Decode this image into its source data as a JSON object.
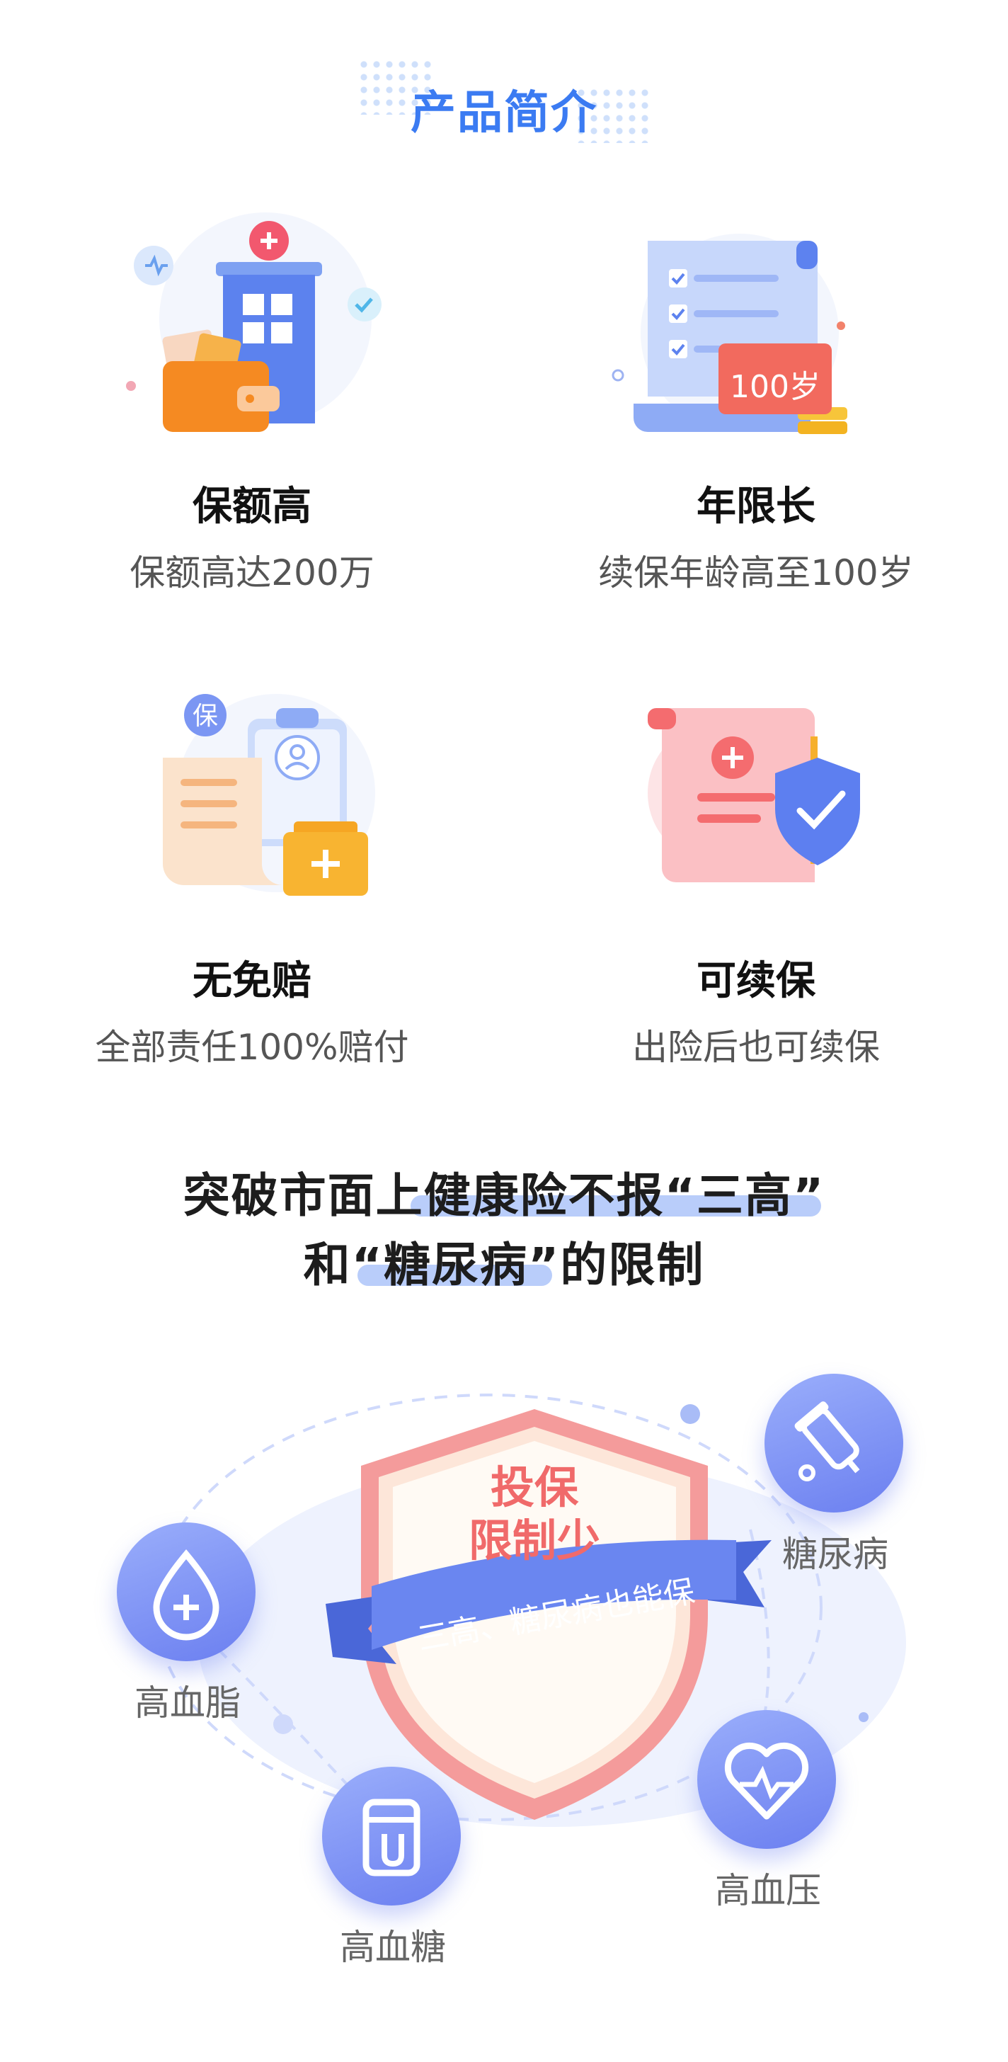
{
  "section": {
    "title": "产品简介"
  },
  "features": [
    {
      "title": "保额高",
      "desc": "保额高达200万"
    },
    {
      "title": "年限长",
      "desc": "续保年龄高至100岁",
      "badge": "100岁"
    },
    {
      "title": "无免赔",
      "desc": "全部责任100%赔付",
      "badge": "保"
    },
    {
      "title": "可续保",
      "desc": "出险后也可续保"
    }
  ],
  "headline": {
    "line1": "突破市面上健康险不报“三高”",
    "line2": "和“糖尿病”的限制"
  },
  "shield": {
    "title_line1": "投保",
    "title_line2": "限制少",
    "ribbon": "三高、糖尿病也能保"
  },
  "conditions": [
    {
      "label": "糖尿病",
      "icon": "dropper-icon"
    },
    {
      "label": "高血脂",
      "icon": "blood-drop-plus-icon"
    },
    {
      "label": "高血压",
      "icon": "heart-pulse-icon"
    },
    {
      "label": "高血糖",
      "icon": "glucose-meter-icon"
    }
  ],
  "colors": {
    "accent_blue": "#3b7bf2",
    "shield_red": "#f26d6d",
    "ribbon_blue": "#6a86f0"
  }
}
